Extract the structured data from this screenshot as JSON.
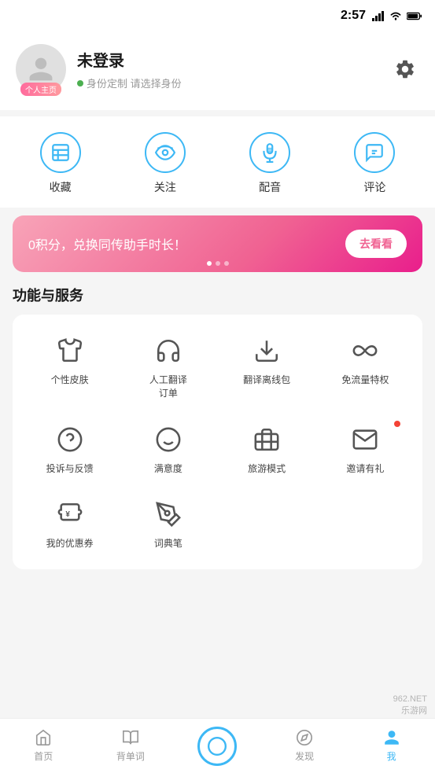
{
  "statusBar": {
    "time": "2:57",
    "icons": [
      "signal",
      "wifi",
      "battery"
    ]
  },
  "header": {
    "avatarTag": "个人主页",
    "profileName": "未登录",
    "profileSub": "身份定制 请选择身份",
    "gearLabel": "设置"
  },
  "quickActions": [
    {
      "id": "collect",
      "label": "收藏",
      "icon": "bookmark"
    },
    {
      "id": "follow",
      "label": "关注",
      "icon": "eye"
    },
    {
      "id": "dubbing",
      "label": "配音",
      "icon": "mic"
    },
    {
      "id": "comment",
      "label": "评论",
      "icon": "comment"
    }
  ],
  "banner": {
    "text": "0积分，兑换同传助手时长！",
    "btnLabel": "去看看",
    "dots": [
      true,
      false,
      false
    ]
  },
  "featuresSection": {
    "title": "功能与服务",
    "items": [
      {
        "id": "skin",
        "label": "个性皮肤",
        "icon": "shirt",
        "badge": false
      },
      {
        "id": "translate",
        "label": "人工翻译\n订单",
        "icon": "headphone",
        "badge": false
      },
      {
        "id": "offline",
        "label": "翻译离线包",
        "icon": "download",
        "badge": false
      },
      {
        "id": "flow",
        "label": "免流量特权",
        "icon": "infinite",
        "badge": false
      },
      {
        "id": "feedback",
        "label": "投诉与反馈",
        "icon": "question",
        "badge": false
      },
      {
        "id": "satisfaction",
        "label": "满意度",
        "icon": "smile",
        "badge": false
      },
      {
        "id": "travel",
        "label": "旅游模式",
        "icon": "suitcase",
        "badge": false
      },
      {
        "id": "invite",
        "label": "邀请有礼",
        "icon": "envelope",
        "badge": true
      },
      {
        "id": "coupon",
        "label": "我的优惠券",
        "icon": "coupon",
        "badge": false
      },
      {
        "id": "dictpen",
        "label": "词典笔",
        "icon": "pen",
        "badge": false
      }
    ]
  },
  "bottomNav": [
    {
      "id": "home",
      "label": "首页",
      "active": false
    },
    {
      "id": "vocab",
      "label": "背单词",
      "active": false
    },
    {
      "id": "center",
      "label": "",
      "active": false,
      "isCenter": true
    },
    {
      "id": "discover",
      "label": "发现",
      "active": false
    },
    {
      "id": "mine",
      "label": "我",
      "active": true
    }
  ],
  "watermark": {
    "line1": "962.NET",
    "line2": "乐游网"
  }
}
